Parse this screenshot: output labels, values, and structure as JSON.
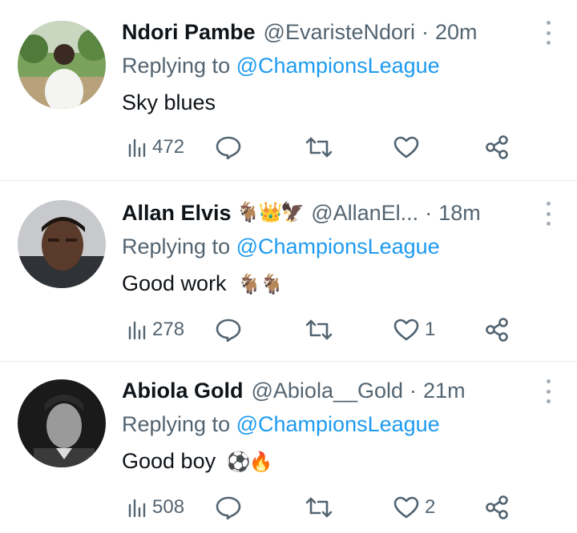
{
  "tweets": [
    {
      "name": "Ndori Pambe",
      "handle": "@EvaristeNdori",
      "separator": "·",
      "time": "20m",
      "name_emoji": "",
      "replying_prefix": "Replying to",
      "replying_to": "@ChampionsLeague",
      "text": "Sky blues",
      "text_emoji": "",
      "views": "472",
      "replies": "",
      "retweets": "",
      "likes": "",
      "icons": [
        "views-icon",
        "reply-icon",
        "retweet-icon",
        "like-icon",
        "share-icon",
        "more-icon"
      ]
    },
    {
      "name": "Allan Elvis",
      "handle": "@AllanEl...",
      "separator": "·",
      "time": "18m",
      "name_emoji": "🐐👑🦅",
      "replying_prefix": "Replying to",
      "replying_to": "@ChampionsLeague",
      "text": "Good work",
      "text_emoji": "🐐🐐",
      "views": "278",
      "replies": "",
      "retweets": "",
      "likes": "1",
      "icons": [
        "views-icon",
        "reply-icon",
        "retweet-icon",
        "like-icon",
        "share-icon",
        "more-icon"
      ]
    },
    {
      "name": "Abiola Gold",
      "handle": "@Abiola__Gold",
      "separator": "·",
      "time": "21m",
      "name_emoji": "",
      "replying_prefix": "Replying to",
      "replying_to": "@ChampionsLeague",
      "text": "Good boy",
      "text_emoji": "⚽🔥",
      "views": "508",
      "replies": "",
      "retweets": "",
      "likes": "2",
      "icons": [
        "views-icon",
        "reply-icon",
        "retweet-icon",
        "like-icon",
        "share-icon",
        "more-icon"
      ]
    }
  ],
  "colors": {
    "accent": "#1d9bf0",
    "secondary_text": "#536471",
    "primary_text": "#0f1419",
    "divider": "#e6ecf0"
  }
}
